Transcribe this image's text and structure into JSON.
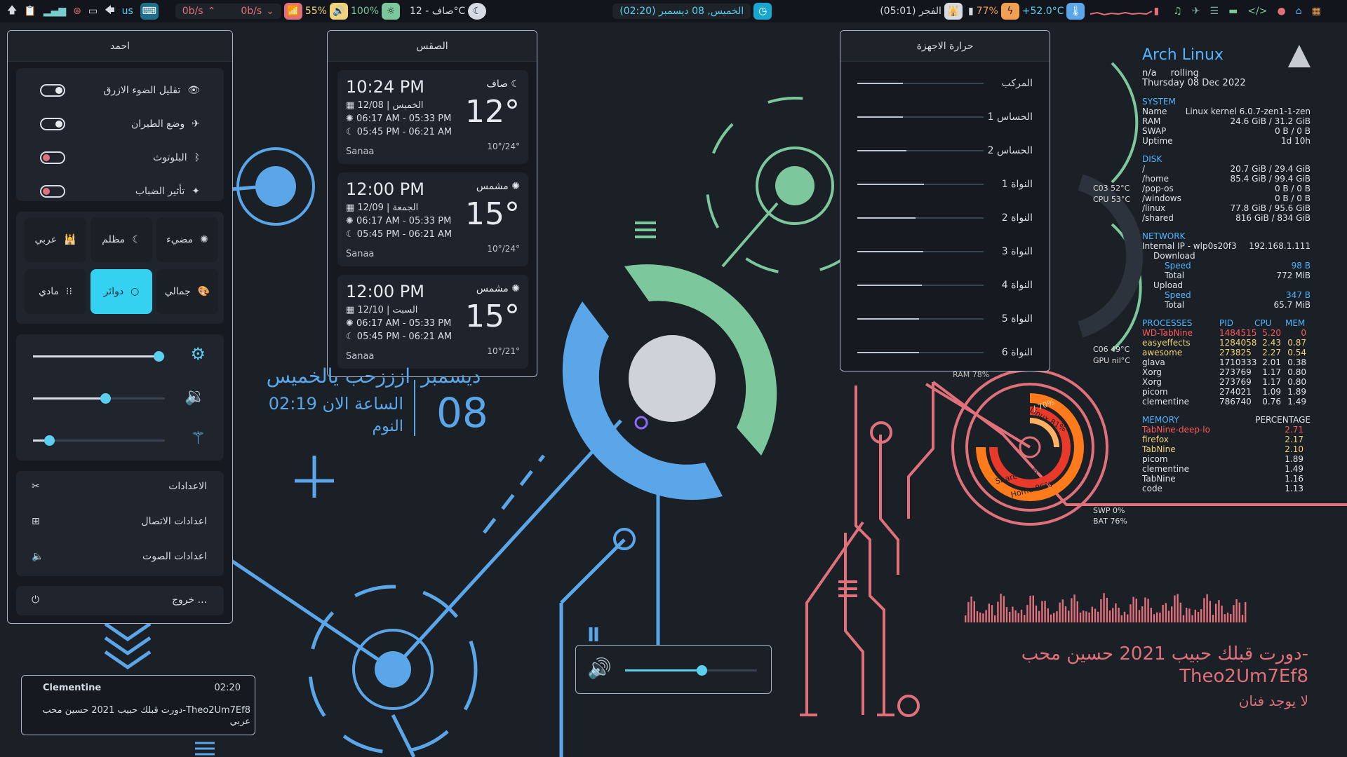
{
  "topbar": {
    "kb_layout": "us",
    "net_down": "0b/s",
    "net_up": "0b/s",
    "brightness": "55%",
    "volume": "100%",
    "weather": "صاف - 12°C",
    "clock": "الخميس, 08 ديسمبر (02:20)",
    "prayer": "الفجر (05:01)",
    "battery": "77%",
    "cpu_temp": "+52.0°C"
  },
  "quick_panel": {
    "title": "احمد",
    "toggles": [
      {
        "label": "تقليل الضوء الازرق",
        "on": true
      },
      {
        "label": "وضع الطيران",
        "on": true
      },
      {
        "label": "البلوتوث",
        "on": false
      },
      {
        "label": "تأثير الضباب",
        "on": false
      }
    ],
    "themes": [
      {
        "label": "مضيء",
        "active": false
      },
      {
        "label": "مظلم",
        "active": false
      },
      {
        "label": "عربي",
        "active": false
      },
      {
        "label": "جمالي",
        "active": false
      },
      {
        "label": "دوائر",
        "active": true
      },
      {
        "label": "مادي",
        "active": false
      }
    ],
    "sliders": {
      "brightness": 0.95,
      "volume": 0.55,
      "blur": 0.12
    },
    "menu": [
      "الاعدادات",
      "اعدادات الاتصال",
      "اعدادات الصوت"
    ],
    "logout": "خروج ..."
  },
  "weather_panel": {
    "title": "الصقس",
    "cards": [
      {
        "time": "10:24 PM",
        "date": "الخميس | 12/08",
        "sun": "06:17 AM - 05:33 PM",
        "moon": "05:45 PM - 06:21 AM",
        "city": "Sanaa",
        "cond": "صاف",
        "temp": "12°",
        "range": "10°/24°"
      },
      {
        "time": "12:00 PM",
        "date": "الجمعة | 12/09",
        "sun": "06:17 AM - 05:33 PM",
        "moon": "05:45 PM - 06:21 AM",
        "city": "Sanaa",
        "cond": "مشمس",
        "temp": "15°",
        "range": "10°/24°"
      },
      {
        "time": "12:00 PM",
        "date": "السبت | 12/10",
        "sun": "06:17 AM - 05:33 PM",
        "moon": "05:45 PM - 06:21 AM",
        "city": "Sanaa",
        "cond": "مشمس",
        "temp": "15°",
        "range": "10°/21°"
      }
    ]
  },
  "temp_panel": {
    "title": "حرارة الاجهزة",
    "rows": [
      {
        "label": "المركب",
        "level": 0.36
      },
      {
        "label": "الحساس 1",
        "level": 0.36
      },
      {
        "label": "الحساس 2",
        "level": 0.39
      },
      {
        "label": "النواة 1",
        "level": 0.53
      },
      {
        "label": "النواة 2",
        "level": 0.46
      },
      {
        "label": "النواة 3",
        "level": 0.52
      },
      {
        "label": "النواة 4",
        "level": 0.51
      },
      {
        "label": "النواة 5",
        "level": 0.49
      },
      {
        "label": "النواة 6",
        "level": 0.49
      }
    ]
  },
  "desktop_clock": {
    "greeting": "ازززحب يالخميس",
    "now": "الساعة الان 02:19",
    "sleep": "النوم",
    "month": "ديسمبر",
    "day": "08"
  },
  "gauges": {
    "ram": "RAM 78%",
    "swap": "SWP 0%",
    "bat": "BAT 76%",
    "c03": "C03 52°C",
    "cpu": "CPU 53°C",
    "c06": "C06 49°C",
    "gpu": "GPU nil°C",
    "ring1": "/ 70%",
    "ring2": "Linux 81%",
    "ring3": "Shared 97%",
    "ring4": "Home 86%"
  },
  "volume_osd": {
    "level": 0.58
  },
  "music_widget": {
    "player": "Clementine",
    "time": "02:20",
    "line1": "دورت قبلك حبيب 2021   حسين محب-Theo2Um7Ef8",
    "line2": "عربي"
  },
  "song_info": {
    "title": "دورت قبلك حبيب 2021   حسين محب-",
    "artist_id": "Theo2Um7Ef8",
    "artist": "لا يوجد فنان"
  },
  "conky": {
    "distro": "Arch Linux",
    "na": "n/a",
    "rolling": "rolling",
    "date": "Thursday 08 Dec 2022",
    "system_h": "SYSTEM",
    "system": [
      [
        "Name",
        "Linux kernel 6.0.7-zen1-1-zen"
      ],
      [
        "RAM",
        "24.6 GiB / 31.2 GiB"
      ],
      [
        "SWAP",
        "0 B / 0 B"
      ],
      [
        "Uptime",
        "1d 10h"
      ]
    ],
    "disk_h": "DISK",
    "disk": [
      [
        "/",
        "20.7 GiB / 29.4 GiB"
      ],
      [
        "/home",
        "85.4 GiB / 99.4 GiB"
      ],
      [
        "/pop-os",
        "0 B / 0 B"
      ],
      [
        "/windows",
        "0 B / 0 B"
      ],
      [
        "/linux",
        "77.8 GiB / 95.6 GiB"
      ],
      [
        "/shared",
        "816 GiB / 834 GiB"
      ]
    ],
    "network_h": "NETWORK",
    "ip_label": "Internal IP - wlp0s20f3",
    "ip": "192.168.1.111",
    "download": "Download",
    "speed": "Speed",
    "total": "Total",
    "dl_speed": "98 B",
    "dl_total": "772 MiB",
    "upload": "Upload",
    "ul_speed": "347 B",
    "ul_total": "65.7 MiB",
    "proc_h": [
      "PROCESSES",
      "PID",
      "CPU",
      "MEM"
    ],
    "procs": [
      [
        "WD-TabNine",
        "1484515",
        "5.20",
        "0"
      ],
      [
        "easyeffects",
        "1284058",
        "2.43",
        "0.87"
      ],
      [
        "awesome",
        "273825",
        "2.27",
        "0.54"
      ],
      [
        "glava",
        "1710333",
        "2.01",
        "0.38"
      ],
      [
        "Xorg",
        "273769",
        "1.17",
        "0.80"
      ],
      [
        "Xorg",
        "273769",
        "1.17",
        "0.80"
      ],
      [
        "picom",
        "274021",
        "1.09",
        "1.89"
      ],
      [
        "clementine",
        "786740",
        "0.76",
        "1.49"
      ]
    ],
    "mem_h": [
      "MEMORY",
      "PERCENTAGE"
    ],
    "mems": [
      [
        "TabNine-deep-lo",
        "2.71"
      ],
      [
        "firefox",
        "2.17"
      ],
      [
        "TabNine",
        "2.10"
      ],
      [
        "picom",
        "1.89"
      ],
      [
        "clementine",
        "1.49"
      ],
      [
        "TabNine",
        "1.16"
      ],
      [
        "code",
        "1.13"
      ]
    ]
  }
}
